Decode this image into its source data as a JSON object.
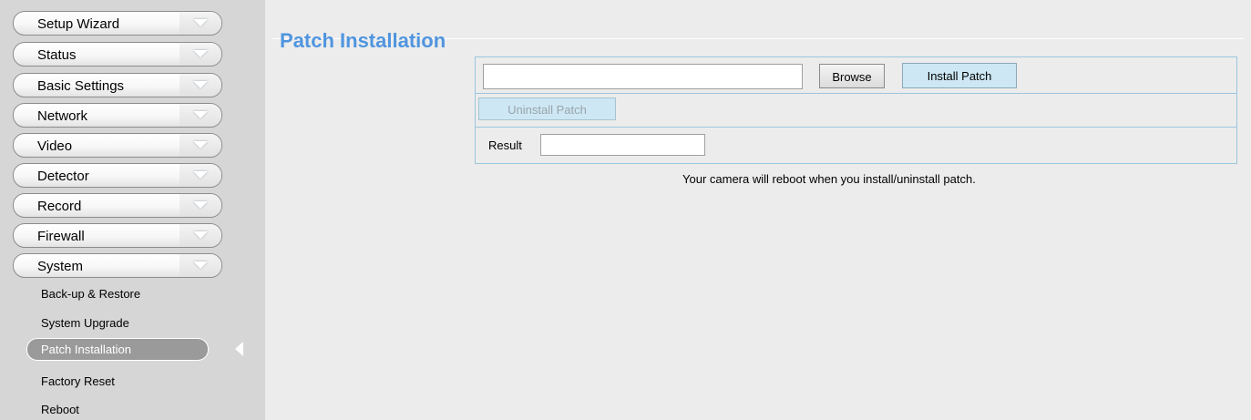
{
  "sidebar": {
    "menu_items": [
      {
        "label": "Setup Wizard"
      },
      {
        "label": "Status"
      },
      {
        "label": "Basic Settings"
      },
      {
        "label": "Network"
      },
      {
        "label": "Video"
      },
      {
        "label": "Detector"
      },
      {
        "label": "Record"
      },
      {
        "label": "Firewall"
      },
      {
        "label": "System"
      }
    ],
    "system_sub_items": [
      {
        "label": "Back-up & Restore"
      },
      {
        "label": "System Upgrade"
      },
      {
        "label": "Patch Installation",
        "selected": true
      },
      {
        "label": "Factory Reset"
      },
      {
        "label": "Reboot"
      }
    ]
  },
  "main": {
    "title": "Patch Installation",
    "file_input_value": "",
    "browse_label": "Browse",
    "install_label": "Install Patch",
    "uninstall_label": "Uninstall Patch",
    "result_label": "Result",
    "result_value": "",
    "note": "Your camera will reboot when you install/uninstall patch."
  },
  "colors": {
    "title": "#4f95df",
    "button_blue": "#cde8f4",
    "table_border": "#9cc6dc",
    "sidebar_bg": "#d6d6d6",
    "content_bg": "#ececec"
  }
}
